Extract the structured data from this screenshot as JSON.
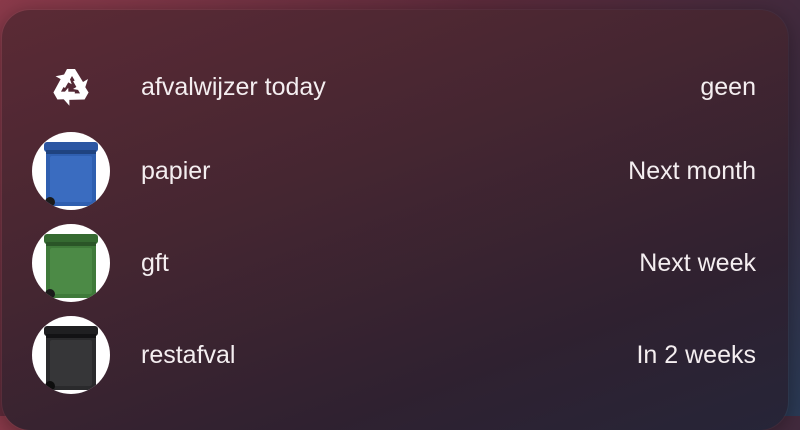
{
  "rows": [
    {
      "icon": "recycle-icon",
      "label": "afvalwijzer today",
      "value": "geen"
    },
    {
      "icon": "blue-bin-icon",
      "label": "papier",
      "value": "Next month",
      "color": "#2f5fb0"
    },
    {
      "icon": "green-bin-icon",
      "label": "gft",
      "value": "Next week",
      "color": "#3f7a3a"
    },
    {
      "icon": "black-bin-icon",
      "label": "restafval",
      "value": "In 2 weeks",
      "color": "#2a2a2c"
    }
  ]
}
